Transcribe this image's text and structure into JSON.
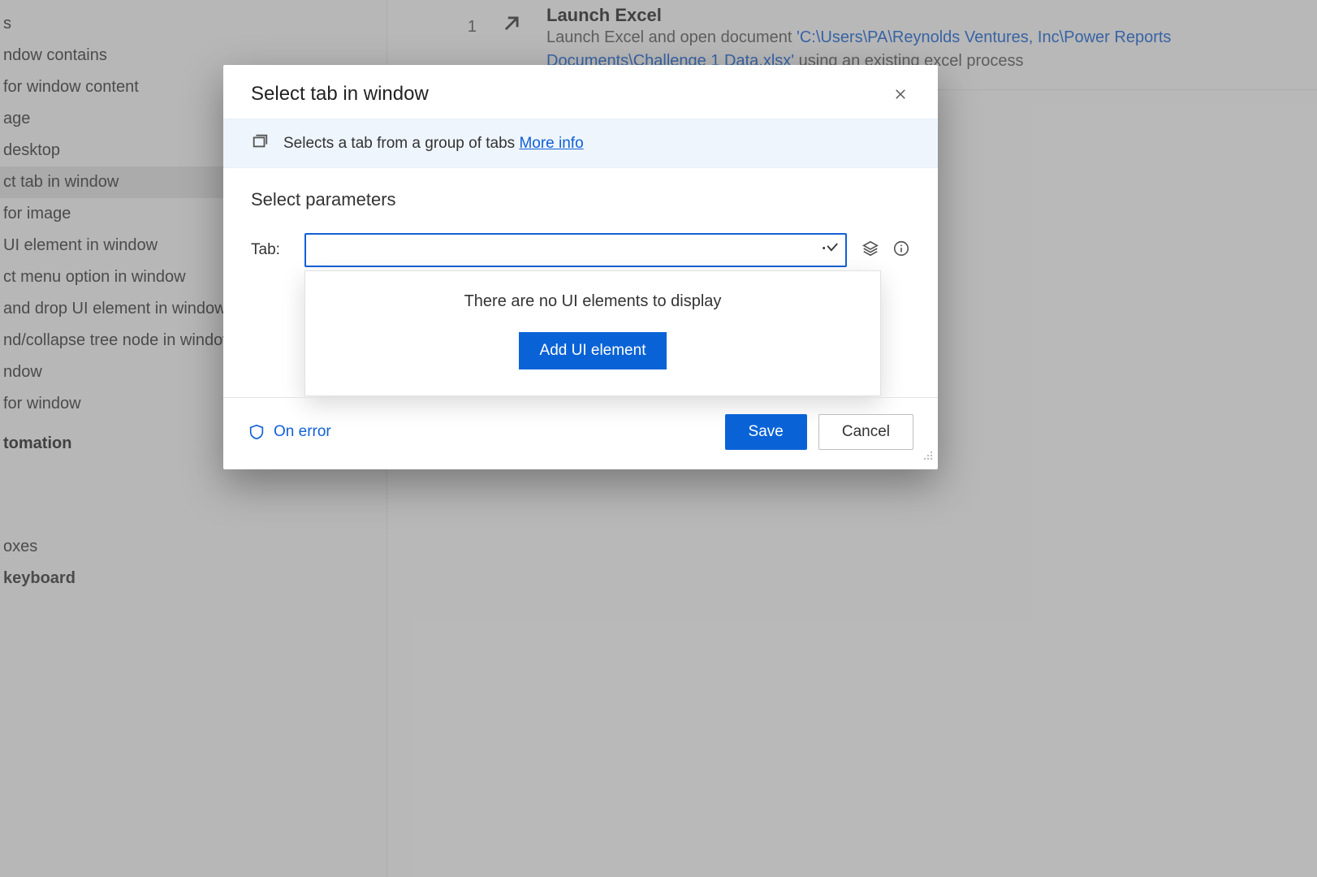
{
  "sidebar": {
    "items": [
      {
        "label": "s"
      },
      {
        "label": "ndow contains"
      },
      {
        "label": "for window content"
      },
      {
        "label": "age"
      },
      {
        "label": "desktop"
      },
      {
        "label": "ct tab in window",
        "selected": true
      },
      {
        "label": "for image"
      },
      {
        "label": "UI element in window"
      },
      {
        "label": "ct menu option in window"
      },
      {
        "label": "and drop UI element in window"
      },
      {
        "label": "nd/collapse tree node in window"
      },
      {
        "label": "ndow"
      },
      {
        "label": "for window"
      }
    ],
    "group1": "tomation",
    "group2_items": [
      {
        "label": "oxes"
      },
      {
        "label": "keyboard"
      }
    ]
  },
  "flow": {
    "index": "1",
    "title": "Launch Excel",
    "desc_prefix": "Launch Excel and open document ",
    "path": "'C:\\Users\\PA\\Reynolds Ventures, Inc\\Power Reports Documents\\Challenge 1 Data.xlsx'",
    "desc_suffix": " using an existing excel process"
  },
  "modal": {
    "title": "Select tab in window",
    "info_text": "Selects a tab from a group of tabs ",
    "more_info": "More info",
    "section_title": "Select parameters",
    "param_label": "Tab:",
    "empty_text": "There are no UI elements to display",
    "add_btn": "Add UI element",
    "on_error": "On error",
    "save": "Save",
    "cancel": "Cancel"
  }
}
